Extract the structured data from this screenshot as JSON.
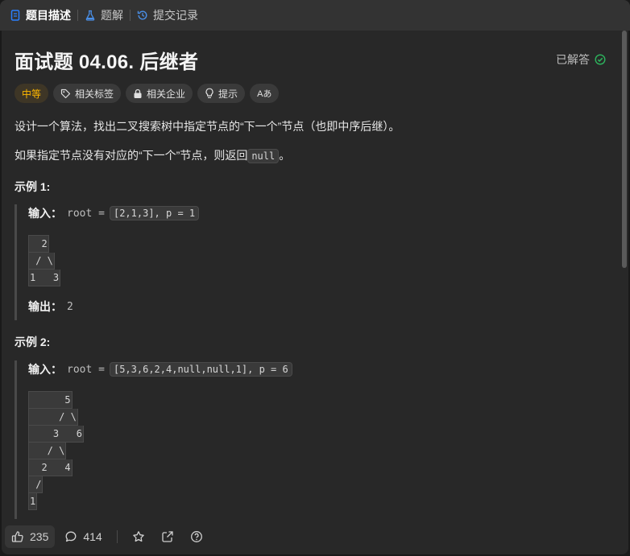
{
  "tabs": [
    {
      "label": "题目描述",
      "icon": "description-icon"
    },
    {
      "label": "题解",
      "icon": "flask-icon"
    },
    {
      "label": "提交记录",
      "icon": "history-icon"
    }
  ],
  "problem": {
    "title": "面试题 04.06. 后继者",
    "status": "已解答",
    "tags": [
      "中等",
      "相关标签",
      "相关企业",
      "提示",
      "Aあ"
    ],
    "desc1": "设计一个算法，找出二叉搜索树中指定节点的“下一个”节点（也即中序后继）。",
    "desc2_before": "如果指定节点没有对应的“下一个”节点，则返回",
    "desc2_code": "null",
    "desc2_after": "。"
  },
  "examples": [
    {
      "heading": "示例 1:",
      "input_label": "输入：",
      "input_prefix": "root =",
      "input_code": "[2,1,3], p = 1",
      "tree": [
        "  2",
        " / \\",
        "1   3"
      ],
      "output_label": "输出：",
      "output_value": "2"
    },
    {
      "heading": "示例 2:",
      "input_label": "输入：",
      "input_prefix": "root =",
      "input_code": "[5,3,6,2,4,null,null,1], p = 6",
      "tree": [
        "      5",
        "     / \\",
        "    3   6",
        "   / \\",
        "  2   4",
        " /",
        "1"
      ]
    }
  ],
  "bottom": {
    "likes": "235",
    "comments": "414"
  },
  "colors": {
    "accent_medium": "#ffb800",
    "solved_green": "#2db55d"
  }
}
